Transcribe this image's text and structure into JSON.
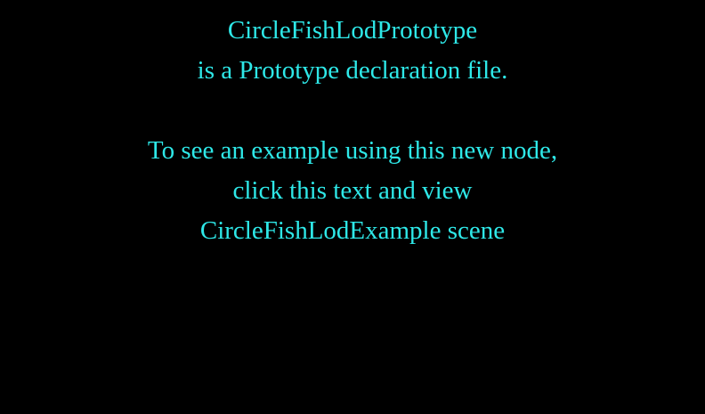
{
  "colors": {
    "background": "#000000",
    "text": "#2ee8e8"
  },
  "message": {
    "title": "CircleFishLodPrototype",
    "subtitle": "is a Prototype declaration file.",
    "link_lines": [
      "To see an example using this new node,",
      "click this text and view",
      "CircleFishLodExample scene"
    ]
  }
}
